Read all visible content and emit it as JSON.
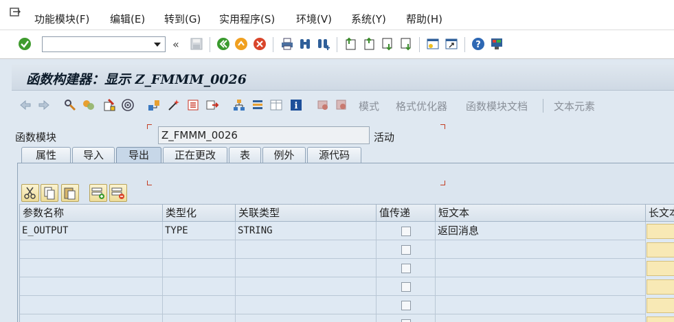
{
  "menubar": {
    "items": [
      "功能模块(F)",
      "编辑(E)",
      "转到(G)",
      "实用程序(S)",
      "环境(V)",
      "系统(Y)",
      "帮助(H)"
    ]
  },
  "toolbar": {
    "command_field_value": "",
    "save_label": "保存"
  },
  "title": "函数构建器：显示 Z_FMMM_0026",
  "app_toolbar": {
    "pattern": "模式",
    "pretty_printer": "格式优化器",
    "fm_doc": "函数模块文档",
    "text_elements": "文本元素"
  },
  "form": {
    "fm_label": "函数模块",
    "fm_value": "Z_FMMM_0026",
    "status": "活动"
  },
  "tabs": [
    "属性",
    "导入",
    "导出",
    "正在更改",
    "表",
    "例外",
    "源代码"
  ],
  "active_tab": "导出",
  "table": {
    "headers": [
      "参数名称",
      "类型化",
      "关联类型",
      "值传递",
      "短文本",
      "长文本"
    ],
    "rows": [
      {
        "name": "E_OUTPUT",
        "typing": "TYPE",
        "assoc_type": "STRING",
        "short_text": "返回消息"
      }
    ]
  }
}
